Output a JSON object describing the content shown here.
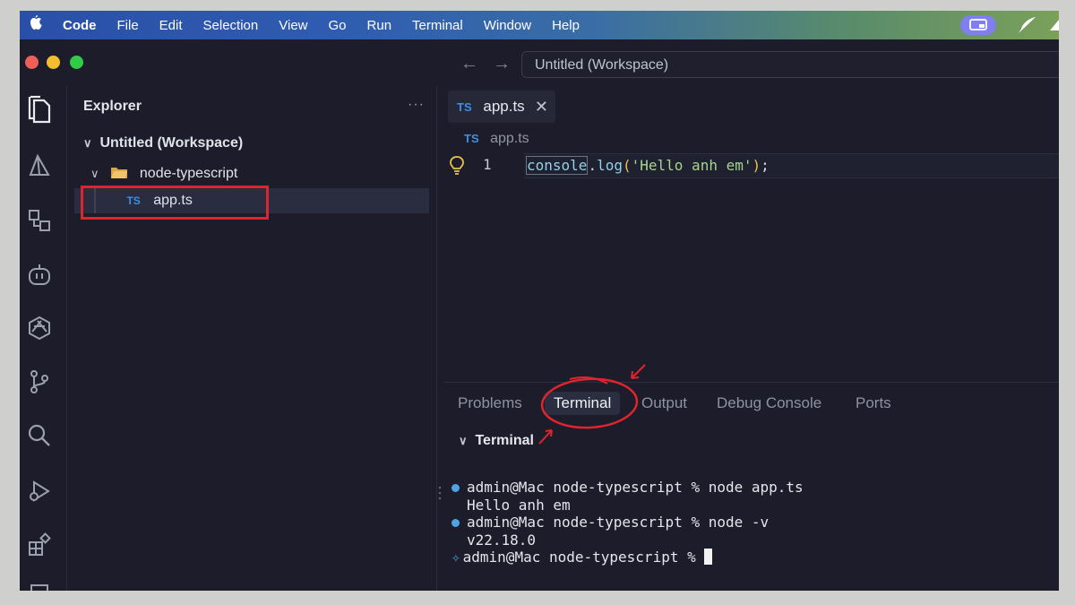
{
  "menubar": {
    "app": "Code",
    "items": [
      "File",
      "Edit",
      "Selection",
      "View",
      "Go",
      "Run",
      "Terminal",
      "Window",
      "Help"
    ]
  },
  "titlebar": {
    "nav_back": "←",
    "nav_forward": "→",
    "command_center": "Untitled (Workspace)"
  },
  "sidebar": {
    "title": "Explorer",
    "more": "···",
    "workspace": "Untitled (Workspace)",
    "folder": "node-typescript",
    "file": "app.ts",
    "file_icon": "TS"
  },
  "editor": {
    "tab_label": "app.ts",
    "tab_icon": "TS",
    "tab_close": "✕",
    "breadcrumb": "app.ts",
    "line_number": "1",
    "code": {
      "fn": "console",
      "dot": ".",
      "method": "log",
      "open": "(",
      "string": "'Hello anh em'",
      "close": ")",
      "semi": ";"
    }
  },
  "panel": {
    "tabs": [
      "Problems",
      "Terminal",
      "Output",
      "Debug Console",
      "Ports"
    ],
    "section": "Terminal",
    "lines": [
      "admin@Mac node-typescript % node app.ts",
      "Hello anh em",
      "admin@Mac node-typescript % node -v",
      "v22.18.0",
      "admin@Mac node-typescript % "
    ]
  },
  "colors": {
    "highlight_red": "#e0242e",
    "ts_blue": "#3f8fe0",
    "terminal_dot": "#4da3e8"
  }
}
